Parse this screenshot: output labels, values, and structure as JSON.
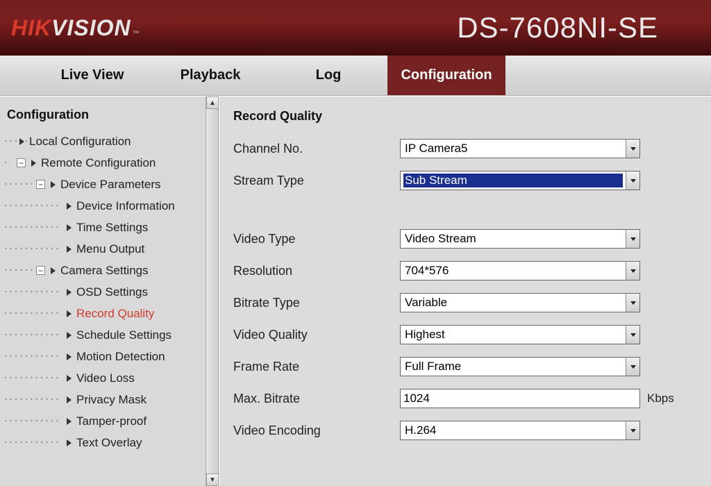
{
  "header": {
    "logo_hik": "HIK",
    "logo_vision": "VISION",
    "tm": "™",
    "model": "DS-7608NI-SE"
  },
  "tabs": [
    {
      "label": "Live View",
      "active": false
    },
    {
      "label": "Playback",
      "active": false
    },
    {
      "label": "Log",
      "active": false
    },
    {
      "label": "Configuration",
      "active": true
    }
  ],
  "sidebar": {
    "title": "Configuration",
    "tree": {
      "local_config": "Local Configuration",
      "remote_config": "Remote Configuration",
      "device_params": "Device Parameters",
      "device_info": "Device Information",
      "time_settings": "Time Settings",
      "menu_output": "Menu Output",
      "camera_settings": "Camera Settings",
      "osd_settings": "OSD Settings",
      "record_quality": "Record Quality",
      "schedule_settings": "Schedule Settings",
      "motion_detection": "Motion Detection",
      "video_loss": "Video Loss",
      "privacy_mask": "Privacy Mask",
      "tamper_proof": "Tamper-proof",
      "text_overlay": "Text Overlay"
    }
  },
  "main": {
    "title": "Record Quality",
    "fields": {
      "channel_no": {
        "label": "Channel No.",
        "value": "IP Camera5"
      },
      "stream_type": {
        "label": "Stream Type",
        "value": "Sub Stream"
      },
      "video_type": {
        "label": "Video Type",
        "value": "Video Stream"
      },
      "resolution": {
        "label": "Resolution",
        "value": "704*576"
      },
      "bitrate_type": {
        "label": "Bitrate Type",
        "value": "Variable"
      },
      "video_quality": {
        "label": "Video Quality",
        "value": "Highest"
      },
      "frame_rate": {
        "label": "Frame Rate",
        "value": "Full Frame"
      },
      "max_bitrate": {
        "label": "Max. Bitrate",
        "value": "1024",
        "unit": "Kbps"
      },
      "video_encoding": {
        "label": "Video Encoding",
        "value": "H.264"
      }
    }
  }
}
